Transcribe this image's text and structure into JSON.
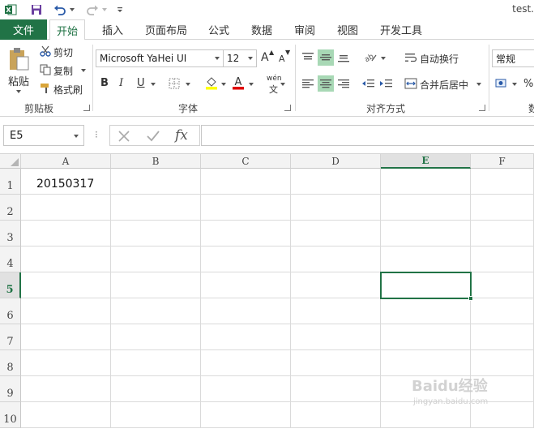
{
  "app": {
    "file_title": "test.",
    "accent": "#217346"
  },
  "tabs": [
    "文件",
    "开始",
    "插入",
    "页面布局",
    "公式",
    "数据",
    "审阅",
    "视图",
    "开发工具"
  ],
  "ribbon": {
    "clipboard": {
      "paste": "粘贴",
      "cut": "剪切",
      "copy": "复制",
      "format_painter": "格式刷",
      "label": "剪贴板"
    },
    "font": {
      "name": "Microsoft YaHei UI",
      "size": "12",
      "bold": "B",
      "italic": "I",
      "underline": "U",
      "increase": "A",
      "decrease": "A",
      "phonetic": "wén",
      "phonetic2": "文",
      "label": "字体"
    },
    "alignment": {
      "wrap": "自动换行",
      "merge": "合并后居中",
      "label": "对齐方式"
    },
    "number": {
      "format": "常规",
      "percent": "%",
      "label": "数"
    }
  },
  "formula_bar": {
    "name_box": "E5",
    "fx": "fx",
    "value": ""
  },
  "grid": {
    "columns": [
      "A",
      "B",
      "C",
      "D",
      "E",
      "F"
    ],
    "rows": [
      "1",
      "2",
      "3",
      "4",
      "5",
      "6",
      "7",
      "8",
      "9",
      "10"
    ],
    "cells": {
      "A1": "20150317"
    },
    "selected": "E5"
  },
  "watermark": {
    "text": "Baidu经验",
    "sub": "jingyan.baidu.com"
  }
}
